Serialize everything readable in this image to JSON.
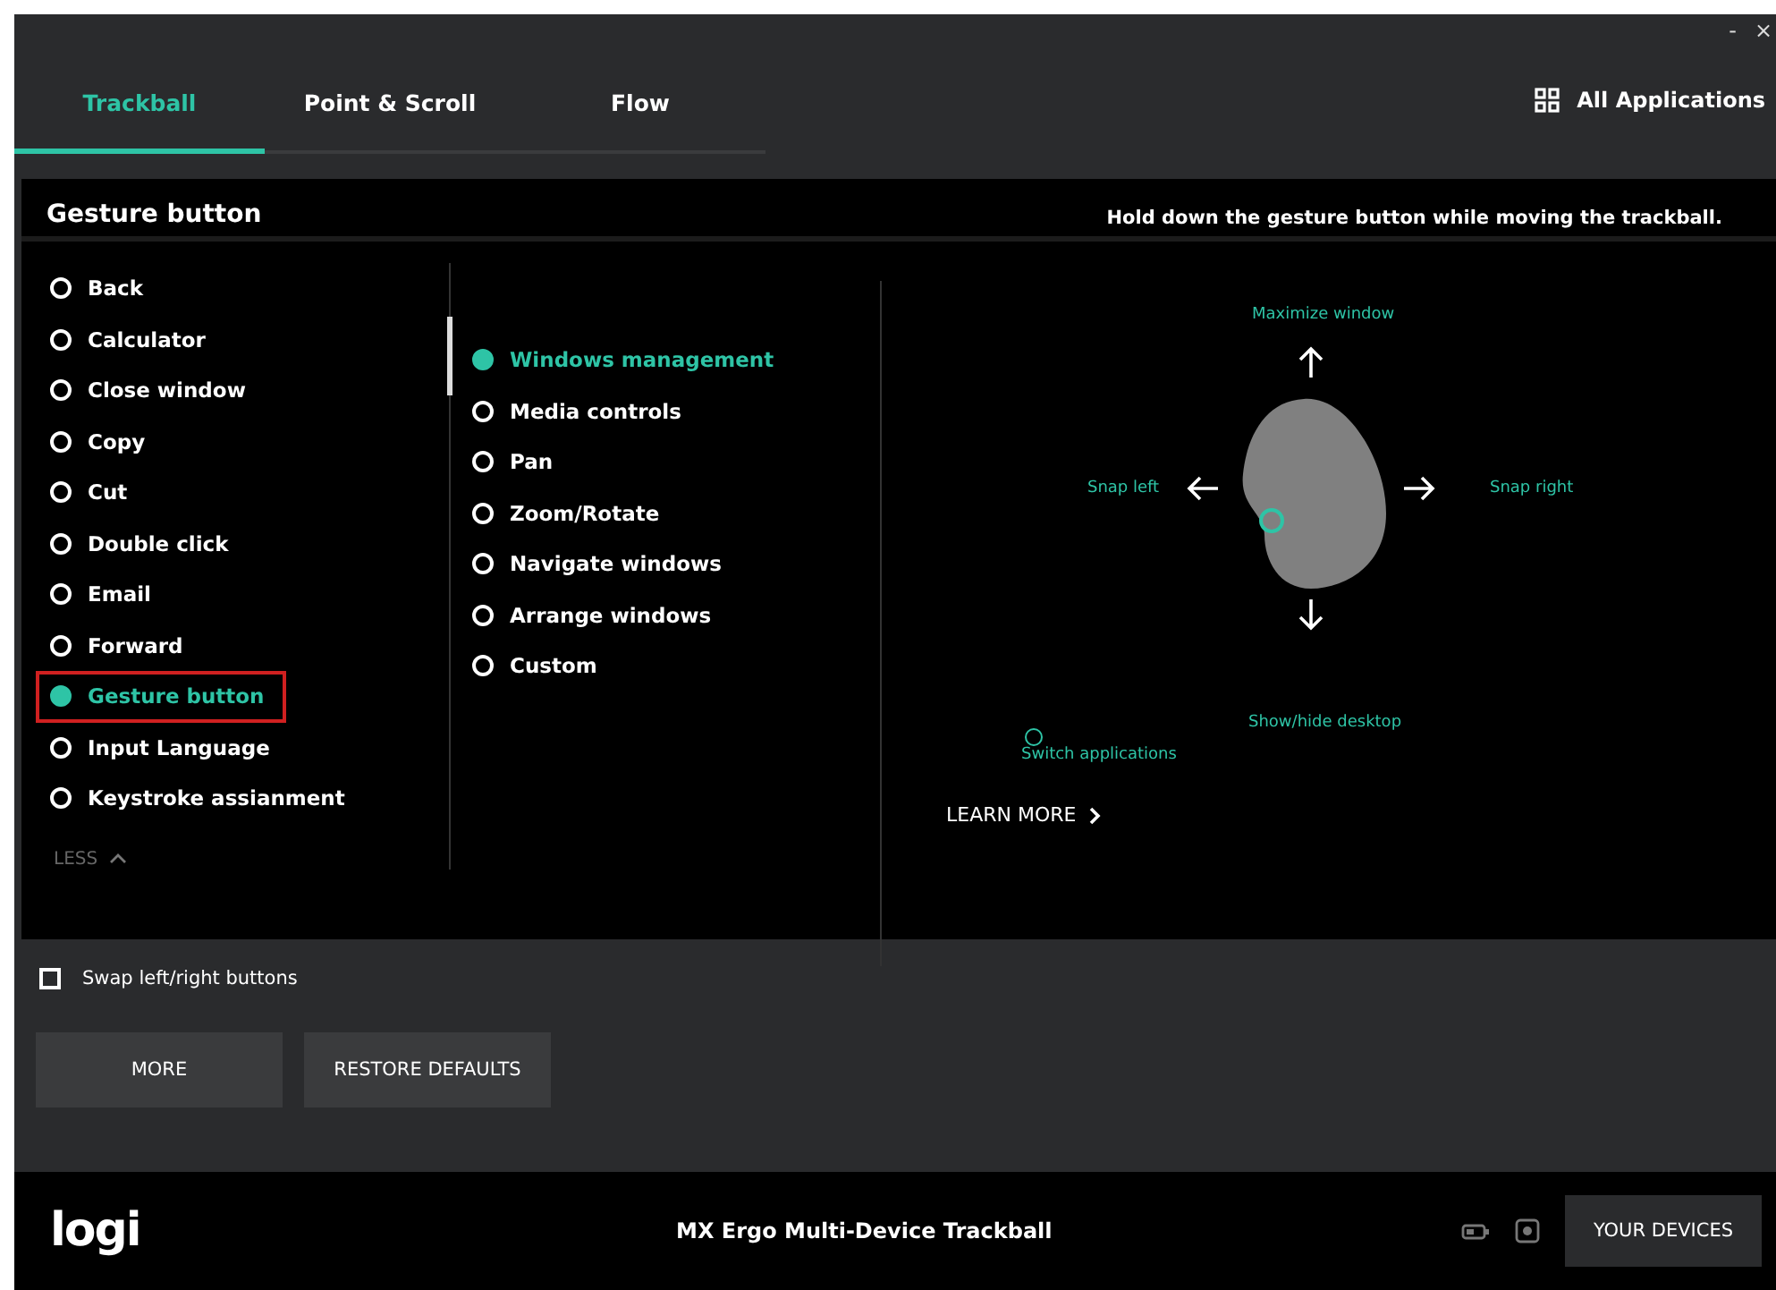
{
  "window": {
    "controls": [
      "-",
      "×"
    ]
  },
  "tabs": [
    {
      "label": "Trackball",
      "selected": true
    },
    {
      "label": "Point & Scroll",
      "selected": false
    },
    {
      "label": "Flow",
      "selected": false
    }
  ],
  "app_selector": {
    "label": "All Applications"
  },
  "panel": {
    "title": "Gesture button",
    "instruction": "Hold down the gesture button while moving the trackball.",
    "actions": [
      {
        "label": "Back",
        "selected": false,
        "highlighted": false
      },
      {
        "label": "Calculator",
        "selected": false,
        "highlighted": false
      },
      {
        "label": "Close window",
        "selected": false,
        "highlighted": false
      },
      {
        "label": "Copy",
        "selected": false,
        "highlighted": false
      },
      {
        "label": "Cut",
        "selected": false,
        "highlighted": false
      },
      {
        "label": "Double click",
        "selected": false,
        "highlighted": false
      },
      {
        "label": "Email",
        "selected": false,
        "highlighted": false
      },
      {
        "label": "Forward",
        "selected": false,
        "highlighted": false
      },
      {
        "label": "Gesture button",
        "selected": true,
        "highlighted": true
      },
      {
        "label": "Input Language",
        "selected": false,
        "highlighted": false
      },
      {
        "label": "Keystroke assianment",
        "selected": false,
        "highlighted": false
      }
    ],
    "less_toggle": "LESS",
    "gesture_sets": [
      {
        "label": "Windows management",
        "selected": true
      },
      {
        "label": "Media controls",
        "selected": false
      },
      {
        "label": "Pan",
        "selected": false
      },
      {
        "label": "Zoom/Rotate",
        "selected": false
      },
      {
        "label": "Navigate windows",
        "selected": false
      },
      {
        "label": "Arrange windows",
        "selected": false
      },
      {
        "label": "Custom",
        "selected": false
      }
    ],
    "diagram": {
      "up": "Maximize window",
      "left": "Snap left",
      "right": "Snap right",
      "down": "Show/hide desktop",
      "click": "Switch applications"
    },
    "learn_more": "LEARN MORE"
  },
  "swap_buttons": {
    "label": "Swap left/right buttons",
    "checked": false
  },
  "buttons": [
    "MORE",
    "RESTORE DEFAULTS"
  ],
  "footer": {
    "logo": "logi",
    "device": "MX Ergo Multi-Device Trackball",
    "devices_button": "YOUR DEVICES"
  }
}
